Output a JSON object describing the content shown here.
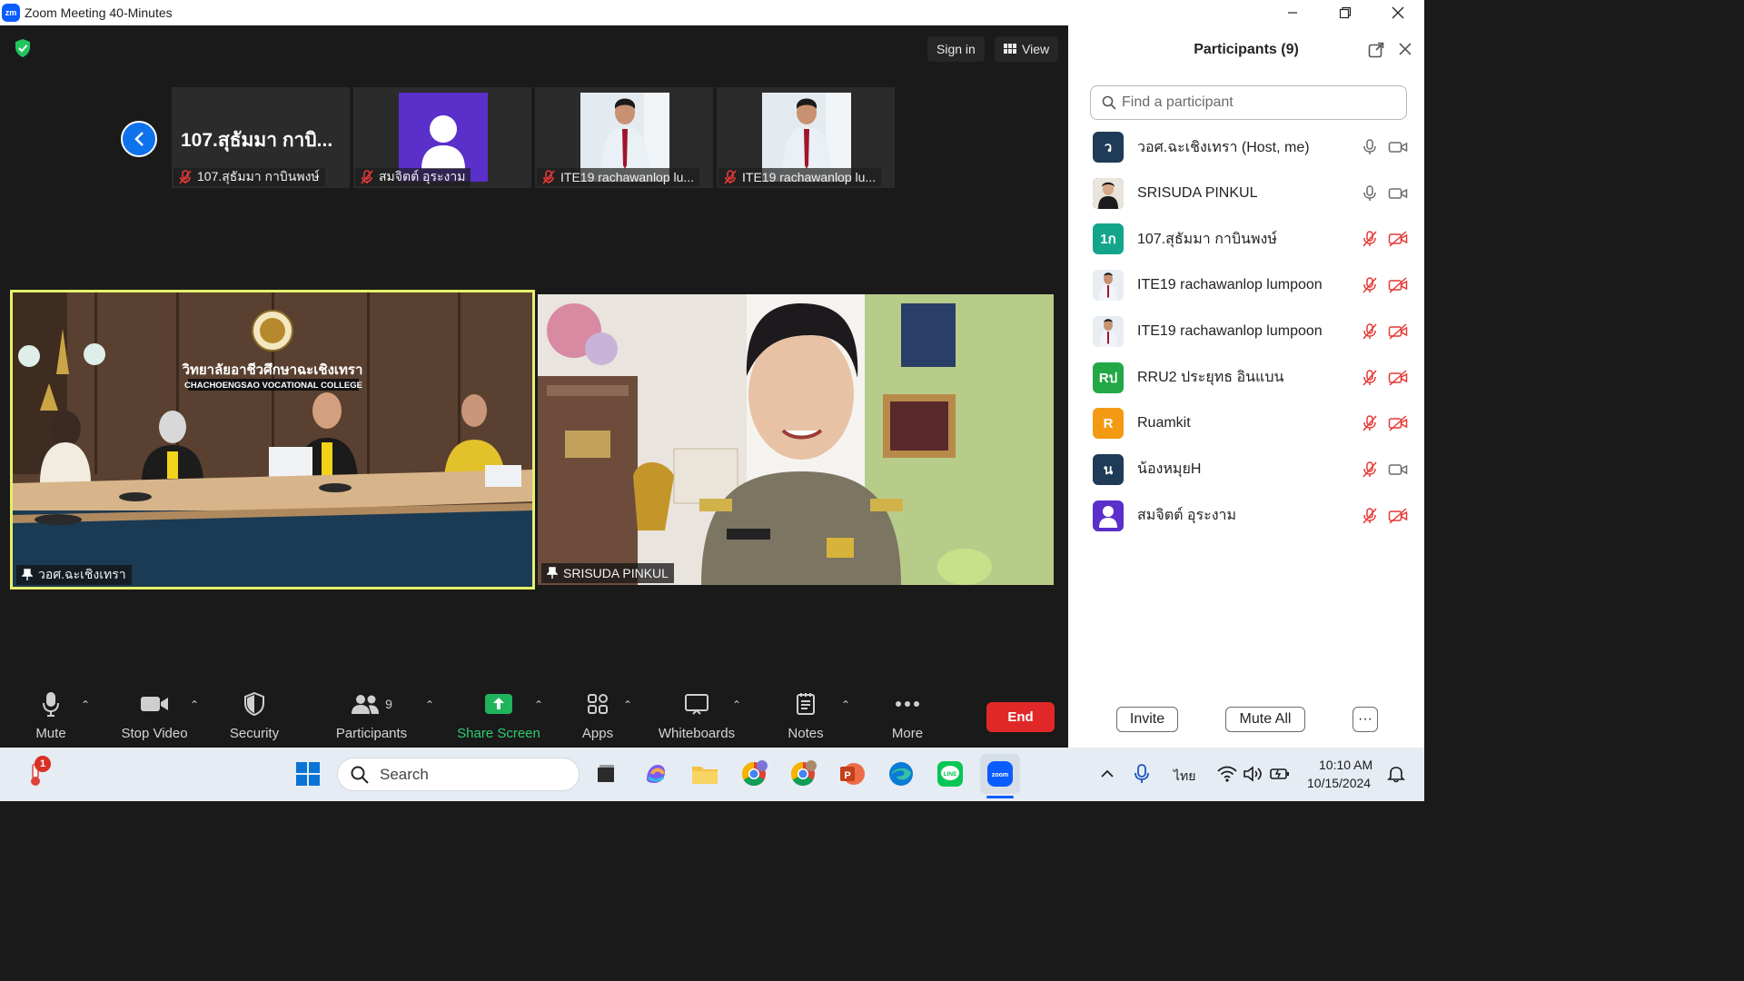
{
  "window": {
    "title": "Zoom Meeting 40-Minutes",
    "logo_text": "zm",
    "controls": [
      "minimize",
      "restore",
      "close"
    ]
  },
  "meeting": {
    "sign_in_label": "Sign in",
    "view_label": "View",
    "thumbnails": [
      {
        "name": "107.สุธัมมา กาบินพงษ์",
        "display_text": "107.สุธัมมา กาบิ...",
        "muted": true,
        "type": "name"
      },
      {
        "name": "สมจิตต์ อุระงาม",
        "muted": true,
        "type": "avatar"
      },
      {
        "name": "ITE19 rachawanlop lu...",
        "muted": true,
        "type": "photo"
      },
      {
        "name": "ITE19 rachawanlop lu...",
        "muted": true,
        "type": "photo"
      }
    ],
    "main_tiles": [
      {
        "name": "วอศ.ฉะเชิงเทรา",
        "active_speaker": true,
        "sign_th": "วิทยาลัยอาชีวศึกษาฉะเชิงเทรา",
        "sign_en": "CHACHOENGSAO VOCATIONAL COLLEGE"
      },
      {
        "name": "SRISUDA PINKUL",
        "active_speaker": false
      }
    ]
  },
  "toolbar": {
    "mute": "Mute",
    "stop_video": "Stop Video",
    "security": "Security",
    "participants": "Participants",
    "participants_count": "9",
    "share_screen": "Share Screen",
    "apps": "Apps",
    "whiteboards": "Whiteboards",
    "notes": "Notes",
    "more": "More",
    "end": "End"
  },
  "panel": {
    "title": "Participants (9)",
    "search_placeholder": "Find a participant",
    "participants": [
      {
        "initials": "ว",
        "name": "วอศ.ฉะเชิงเทรา (Host, me)",
        "avatar_color": "#1f3b57",
        "mic_on": true,
        "cam_on": true
      },
      {
        "initials": "",
        "name": "SRISUDA PINKUL",
        "avatar_color": "#2d2a26",
        "mic_on": true,
        "cam_on": true
      },
      {
        "initials": "1ก",
        "name": "107.สุธัมมา กาบินพงษ์",
        "avatar_color": "#13a58a",
        "mic_on": false,
        "cam_on": false
      },
      {
        "initials": "",
        "name": "ITE19 rachawanlop lumpoon",
        "avatar_color": "#dfe6ec",
        "mic_on": false,
        "cam_on": false
      },
      {
        "initials": "",
        "name": "ITE19 rachawanlop lumpoon",
        "avatar_color": "#dfe6ec",
        "mic_on": false,
        "cam_on": false
      },
      {
        "initials": "Rป",
        "name": "RRU2 ประยุทธ อินแบน",
        "avatar_color": "#22a845",
        "mic_on": false,
        "cam_on": false
      },
      {
        "initials": "R",
        "name": "Ruamkit",
        "avatar_color": "#f39a12",
        "mic_on": false,
        "cam_on": false
      },
      {
        "initials": "น",
        "name": "น้องหมุยH",
        "avatar_color": "#1f3b57",
        "mic_on": false,
        "cam_on": true
      },
      {
        "initials": "",
        "name": "สมจิตต์ อุระงาม",
        "avatar_color": "#5b2fc9",
        "mic_on": false,
        "cam_on": false
      }
    ],
    "invite_label": "Invite",
    "mute_all_label": "Mute All",
    "more_label": "···"
  },
  "taskbar": {
    "search_label": "Search",
    "notification_badge": "1",
    "language": "ไทย",
    "time": "10:10 AM",
    "date": "10/15/2024",
    "colors": {
      "accent": "#0b5cff",
      "end": "#e02828",
      "share": "#1fb35b"
    }
  }
}
